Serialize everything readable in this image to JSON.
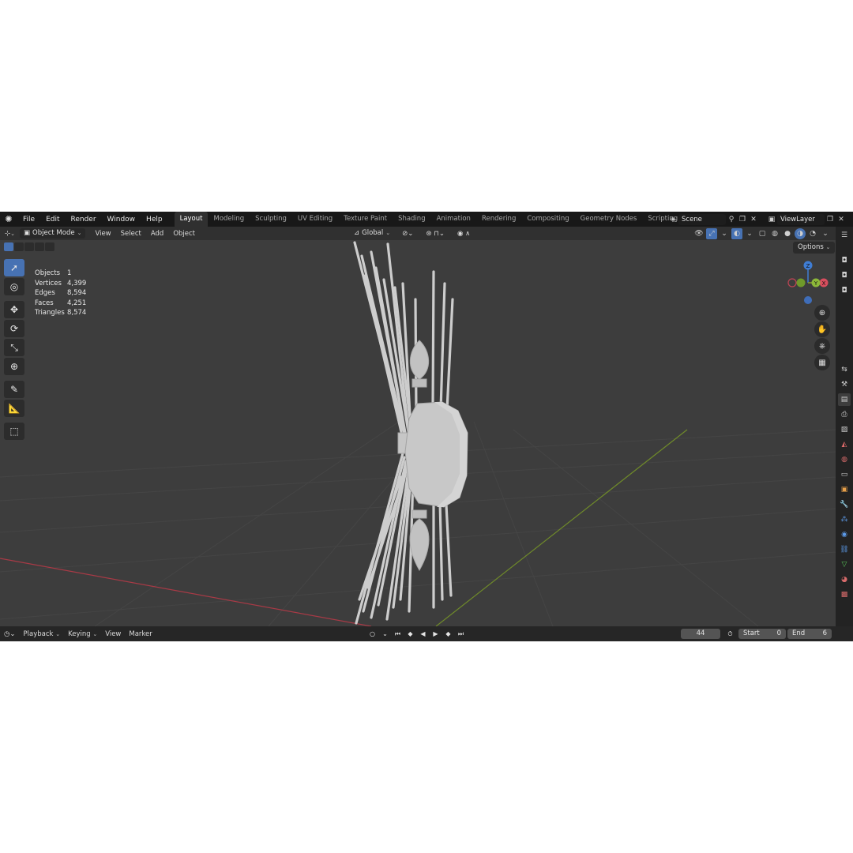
{
  "menubar": {
    "items": [
      "File",
      "Edit",
      "Render",
      "Window",
      "Help"
    ]
  },
  "workspaces": {
    "tabs": [
      "Layout",
      "Modeling",
      "Sculpting",
      "UV Editing",
      "Texture Paint",
      "Shading",
      "Animation",
      "Rendering",
      "Compositing",
      "Geometry Nodes",
      "Scripting"
    ],
    "active": "Layout",
    "add_symbol": "+"
  },
  "scene": {
    "name": "Scene"
  },
  "view_layer": {
    "name": "ViewLayer"
  },
  "header": {
    "mode": "Object Mode",
    "menus": [
      "View",
      "Select",
      "Add",
      "Object"
    ],
    "orientation": "Global"
  },
  "viewport": {
    "options_label": "Options",
    "stats": [
      {
        "label": "Objects",
        "value": "1"
      },
      {
        "label": "Vertices",
        "value": "4,399"
      },
      {
        "label": "Edges",
        "value": "8,594"
      },
      {
        "label": "Faces",
        "value": "4,251"
      },
      {
        "label": "Triangles",
        "value": "8,574"
      }
    ],
    "gizmo": {
      "z": "Z",
      "y": "Y",
      "x": "X"
    },
    "colors": {
      "background": "#3d3d3d",
      "x_axis": "#a83a46",
      "y_axis": "#6f8a2a",
      "object": "#c9c9c9"
    }
  },
  "timeline": {
    "menus": [
      "Playback",
      "Keying",
      "View",
      "Marker"
    ],
    "current_frame": "44",
    "start_label": "Start",
    "start_value": "0",
    "end_label": "End",
    "end_value": "6"
  }
}
